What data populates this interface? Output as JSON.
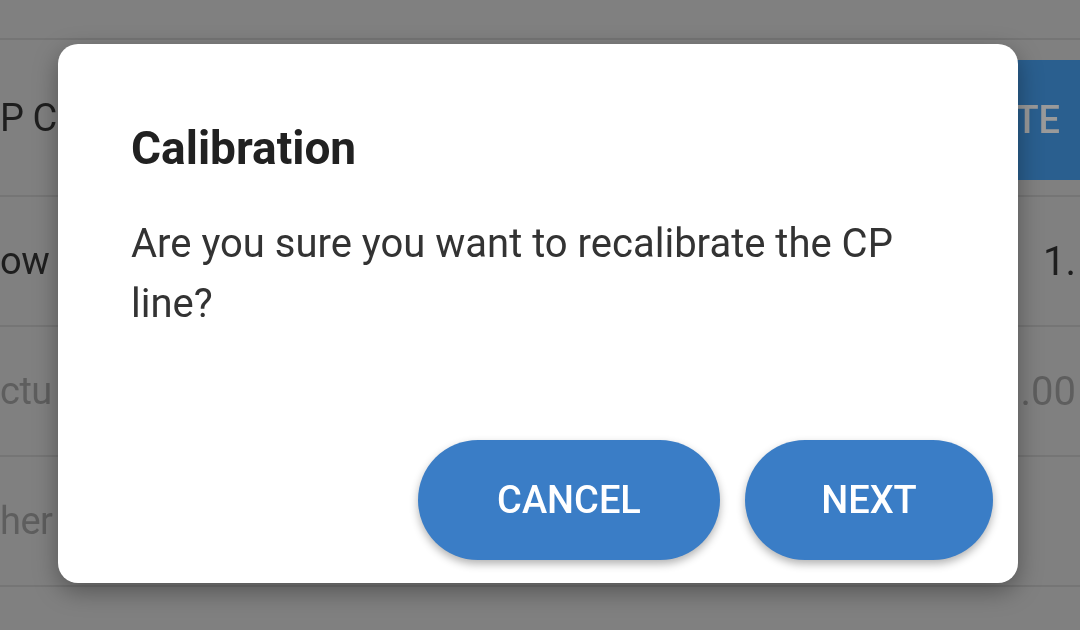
{
  "background": {
    "rows": [
      {
        "label": "P C",
        "kind": "button",
        "value": "TE",
        "disabled": false
      },
      {
        "label": "ow",
        "kind": "text",
        "value": "1.",
        "disabled": false
      },
      {
        "label": "ctu",
        "kind": "text",
        "value": ".00",
        "disabled": true
      },
      {
        "label": "her",
        "kind": "none",
        "disabled": true
      }
    ]
  },
  "dialog": {
    "title": "Calibration",
    "message": "Are you sure you want to recalibrate the CP line?",
    "buttons": [
      "CANCEL",
      "NEXT"
    ]
  }
}
